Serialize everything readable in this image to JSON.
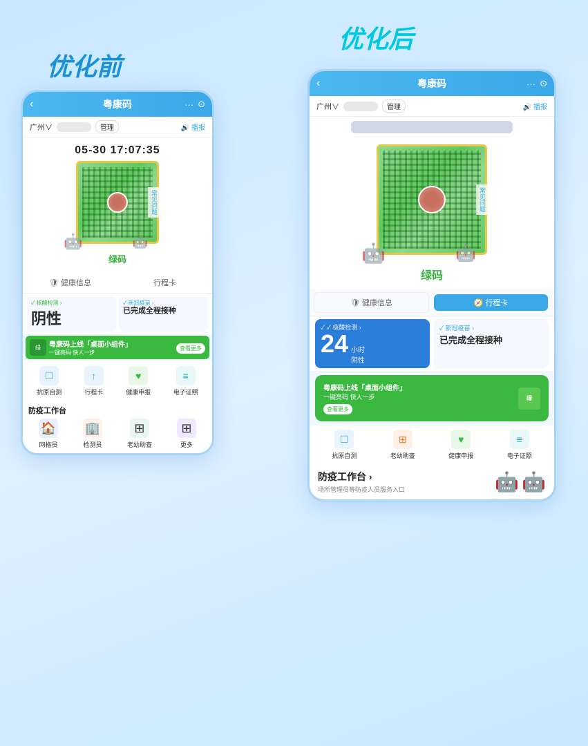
{
  "before_label": "优化前",
  "after_label": "优化后",
  "before_phone": {
    "topbar": {
      "title": "粤康码",
      "back": "‹",
      "dots": "···",
      "target": "⊙"
    },
    "subbar": {
      "location": "广州∨",
      "manage": "管理",
      "broadcast": "🔊 播报"
    },
    "datetime": "05-30 17:07:35",
    "qr_label": "绿码",
    "side_label": "常见问题",
    "tabs": {
      "health": "健康信息",
      "travel": "行程卡"
    },
    "health": {
      "nucleic_tag": "✓ 核酸检测 ›",
      "nucleic_value": "阴性",
      "vaccine_tag": "✓ 新冠疫苗 ›",
      "vaccine_value": "已完成全程接种"
    },
    "banner": {
      "title": "粤康码上线「桌面小组件」",
      "subtitle": "一键亮码 快人一步",
      "cta": "查看更多"
    },
    "icons": [
      {
        "label": "抗原自测",
        "icon": "☐"
      },
      {
        "label": "行程卡",
        "icon": "↑"
      },
      {
        "label": "健康申报",
        "icon": "♥"
      },
      {
        "label": "电子证照",
        "icon": "≡"
      }
    ],
    "work_section": {
      "title": "防疫工作台",
      "items": [
        {
          "label": "网格员",
          "icon": "🏠"
        },
        {
          "label": "检测员",
          "icon": "🏢"
        },
        {
          "label": "老幼助查",
          "icon": "⊞"
        },
        {
          "label": "更多",
          "icon": "⊞"
        }
      ]
    }
  },
  "after_phone": {
    "topbar": {
      "title": "粤康码",
      "back": "‹",
      "dots": "···",
      "target": "⊙"
    },
    "subbar": {
      "location": "广州∨",
      "manage": "管理",
      "broadcast": "🔊 播报"
    },
    "qr_label": "绿码",
    "side_label": "常见问题",
    "tabs": {
      "health": "🛡 健康信息",
      "travel": "🧭 行程卡"
    },
    "health": {
      "nucleic_tag": "✓ 核酸检测 ›",
      "hours": "24",
      "hours_label": "小时",
      "nucleic_value": "阴性",
      "vaccine_tag": "✓ 新冠疫苗 ›",
      "vaccine_value": "已完成全程接种"
    },
    "banner": {
      "title": "粤康码上线「桌面小组件」",
      "subtitle": "一键亮码 快人一步",
      "cta": "查看更多"
    },
    "icons": [
      {
        "label": "抗原自测",
        "icon": "☐"
      },
      {
        "label": "老幼助查",
        "icon": "⊞"
      },
      {
        "label": "健康申报",
        "icon": "♥"
      },
      {
        "label": "电子证照",
        "icon": "≡"
      }
    ],
    "work_section": {
      "title": "防疫工作台 ›",
      "subtitle": "场所管理员等防疫人员服务入口"
    }
  }
}
